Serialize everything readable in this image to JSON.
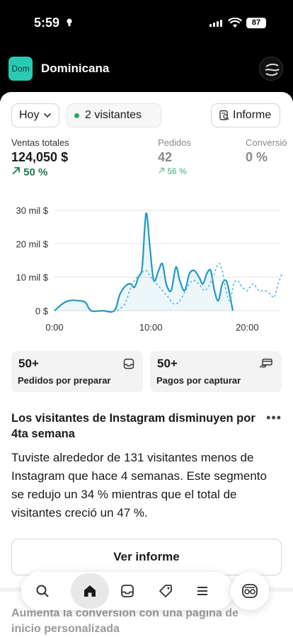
{
  "status_bar": {
    "time": "5:59",
    "battery": "87"
  },
  "header": {
    "store_badge": "Dom",
    "store_name": "Dominicana"
  },
  "toolbar": {
    "date_filter": "Hoy",
    "visitors": "2 visitantes",
    "report_button": "Informe"
  },
  "metrics": [
    {
      "label": "Ventas totales",
      "value": "124,050 $",
      "change": "50 %"
    },
    {
      "label": "Pedidos",
      "value": "42",
      "change": "56 %"
    },
    {
      "label": "Conversió",
      "value": "0 %"
    }
  ],
  "chart_data": {
    "type": "line",
    "y_ticks": [
      "30 mil $",
      "20 mil $",
      "10 mil $",
      "0 $"
    ],
    "x_ticks": [
      "0:00",
      "10:00",
      "20:00"
    ],
    "ylim": [
      0,
      30000
    ],
    "xlim": [
      0,
      23.5
    ],
    "grid": true,
    "series": [
      {
        "style": "solid",
        "color": "#1f9ac4",
        "points": [
          [
            0,
            0
          ],
          [
            0.8,
            2000
          ],
          [
            1.5,
            3000
          ],
          [
            2.5,
            3000
          ],
          [
            3.2,
            2500
          ],
          [
            3.8,
            0
          ],
          [
            5,
            0
          ],
          [
            6.2,
            0
          ],
          [
            6.8,
            5000
          ],
          [
            7.4,
            7500
          ],
          [
            7.9,
            8000
          ],
          [
            8.3,
            7000
          ],
          [
            8.7,
            10000
          ],
          [
            9.1,
            13000
          ],
          [
            9.5,
            29000
          ],
          [
            9.9,
            19000
          ],
          [
            10.3,
            9000
          ],
          [
            10.8,
            12000
          ],
          [
            11.2,
            14000
          ],
          [
            11.6,
            8000
          ],
          [
            12.1,
            6000
          ],
          [
            12.6,
            13000
          ],
          [
            13.0,
            9000
          ],
          [
            13.5,
            6000
          ],
          [
            14.0,
            11000
          ],
          [
            14.5,
            12000
          ],
          [
            15.0,
            10000
          ],
          [
            15.4,
            8000
          ],
          [
            15.8,
            11000
          ],
          [
            16.2,
            12000
          ],
          [
            16.6,
            6000
          ],
          [
            17.0,
            3000
          ],
          [
            17.4,
            8000
          ],
          [
            17.8,
            9000
          ],
          [
            18.1,
            6000
          ],
          [
            18.5,
            0
          ]
        ]
      },
      {
        "style": "dashed",
        "color": "#5bb8da",
        "points": [
          [
            6.5,
            0
          ],
          [
            7.3,
            2000
          ],
          [
            7.8,
            6000
          ],
          [
            8.3,
            9000
          ],
          [
            8.9,
            11000
          ],
          [
            9.5,
            12000
          ],
          [
            10.0,
            10000
          ],
          [
            10.6,
            8000
          ],
          [
            11.2,
            6000
          ],
          [
            11.8,
            4000
          ],
          [
            12.4,
            2000
          ],
          [
            13.0,
            3000
          ],
          [
            13.6,
            6000
          ],
          [
            14.3,
            9000
          ],
          [
            15.0,
            8000
          ],
          [
            15.6,
            6000
          ],
          [
            16.3,
            9000
          ],
          [
            17.0,
            14000
          ],
          [
            17.4,
            12000
          ],
          [
            17.8,
            6000
          ],
          [
            18.2,
            3000
          ],
          [
            18.6,
            8000
          ],
          [
            19.0,
            9000
          ],
          [
            19.5,
            7000
          ],
          [
            20.0,
            6000
          ],
          [
            20.6,
            8000
          ],
          [
            21.2,
            6000
          ],
          [
            21.8,
            6000
          ],
          [
            22.4,
            5000
          ],
          [
            22.8,
            4000
          ],
          [
            23.2,
            8000
          ],
          [
            23.6,
            11000
          ]
        ]
      }
    ]
  },
  "tiles": [
    {
      "count": "50+",
      "label": "Pedidos por preparar",
      "icon": "inbox-icon"
    },
    {
      "count": "50+",
      "label": "Pagos por capturar",
      "icon": "card-hand-icon"
    }
  ],
  "insight": {
    "title": "Los visitantes de Instagram disminuyen por 4ta semana",
    "body": "Tuviste alrededor de 131 visitantes menos de Instagram que hace 4 semanas. Este segmento se redujo un 34 % mientras que el total de visitantes creció un 47 %.",
    "button": "Ver informe",
    "more": "•••"
  },
  "next_card": {
    "title": "Aumenta la conversión con una página de inicio personalizada"
  },
  "bottom_nav": [
    "search-icon",
    "home-icon",
    "orders-icon",
    "tag-icon",
    "menu-icon"
  ],
  "colors": {
    "accent": "#1f9ac4",
    "positive": "#237a4e",
    "badge": "#2bc8b4"
  }
}
